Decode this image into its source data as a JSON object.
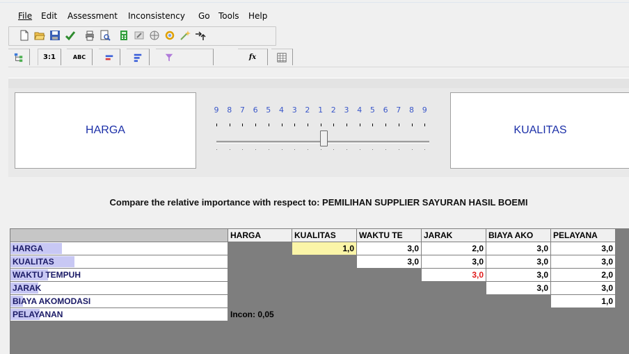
{
  "menu": [
    "File",
    "Edit",
    "Assessment",
    "Inconsistency",
    "Go",
    "Tools",
    "Help"
  ],
  "toolbar_icons": [
    "new-file-icon",
    "open-folder-icon",
    "save-icon",
    "check-arrow-icon",
    "print-icon",
    "print-preview-icon",
    "calculator-icon",
    "edit-icon",
    "globe-icon",
    "refresh-icon",
    "magic-wand-icon",
    "arrow-right-icon"
  ],
  "tabs": [
    {
      "label": "",
      "icon": "tree-icon"
    },
    {
      "label": "3:1",
      "icon": ""
    },
    {
      "label": "ABC",
      "icon": ""
    },
    {
      "label": "",
      "icon": "bar-icon"
    },
    {
      "label": "",
      "icon": "bars-icon"
    },
    {
      "label": "",
      "icon": "funnel-icon"
    },
    {
      "label": "fx",
      "icon": ""
    },
    {
      "label": "",
      "icon": "grid-icon"
    }
  ],
  "compare": {
    "left": "HARGA",
    "right": "KUALITAS",
    "scale": [
      "9",
      "8",
      "7",
      "6",
      "5",
      "4",
      "3",
      "2",
      "1",
      "2",
      "3",
      "4",
      "5",
      "6",
      "7",
      "8",
      "9"
    ],
    "slider_position": 1
  },
  "prompt": "Compare the relative importance with respect to: PEMILIHAN SUPPLIER SAYURAN HASIL BOEMI",
  "matrix": {
    "columns": [
      "HARGA",
      "KUALITAS",
      "WAKTU TE",
      "JARAK",
      "BIAYA AKO",
      "PELAYANA"
    ],
    "rows": [
      {
        "label": "HARGA",
        "cells": [
          "",
          "1,0",
          "3,0",
          "2,0",
          "3,0",
          "3,0"
        ]
      },
      {
        "label": "KUALITAS",
        "cells": [
          "",
          "",
          "3,0",
          "3,0",
          "3,0",
          "3,0"
        ]
      },
      {
        "label": "WAKTU TEMPUH",
        "cells": [
          "",
          "",
          "",
          "3,0",
          "3,0",
          "2,0"
        ]
      },
      {
        "label": "JARAK",
        "cells": [
          "",
          "",
          "",
          "",
          "3,0",
          "3,0"
        ]
      },
      {
        "label": "BIAYA AKOMODASI",
        "cells": [
          "",
          "",
          "",
          "",
          "",
          "1,0"
        ]
      },
      {
        "label": "PELAYANAN",
        "cells": [
          "Incon: 0,05",
          "",
          "",
          "",
          "",
          ""
        ]
      }
    ],
    "selected_value_color": "#fbf5a8",
    "inverted_value_color": "#e01b1b"
  }
}
